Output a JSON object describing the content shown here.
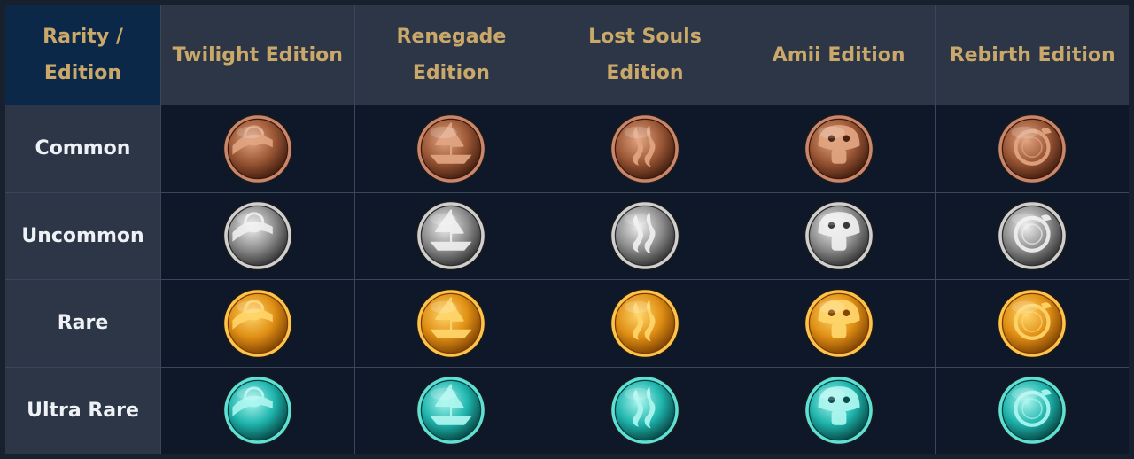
{
  "table": {
    "corner_label": "Rarity / Edition",
    "editions": [
      {
        "label": "Twilight Edition",
        "icon": "eclipse-icon"
      },
      {
        "label": "Renegade Edition",
        "icon": "ship-icon"
      },
      {
        "label": "Lost Souls Edition",
        "icon": "flame-wisp-icon"
      },
      {
        "label": "Amii Edition",
        "icon": "mushroom-icon"
      },
      {
        "label": "Rebirth Edition",
        "icon": "serpent-ring-icon"
      }
    ],
    "rarities": [
      {
        "label": "Common",
        "palette": {
          "light": "#e2a582",
          "mid": "#9b5736",
          "dark": "#3e1a0c",
          "rim": "#c9866a"
        }
      },
      {
        "label": "Uncommon",
        "palette": {
          "light": "#f0f0f0",
          "mid": "#8e8e8e",
          "dark": "#2e2e2e",
          "rim": "#cfcfcf"
        }
      },
      {
        "label": "Rare",
        "palette": {
          "light": "#ffd66b",
          "mid": "#e08f14",
          "dark": "#7a3e02",
          "rim": "#ffc34a"
        }
      },
      {
        "label": "Ultra Rare",
        "palette": {
          "light": "#aef7f0",
          "mid": "#1fb5ad",
          "dark": "#05413f",
          "rim": "#5fe0d6"
        }
      }
    ]
  }
}
